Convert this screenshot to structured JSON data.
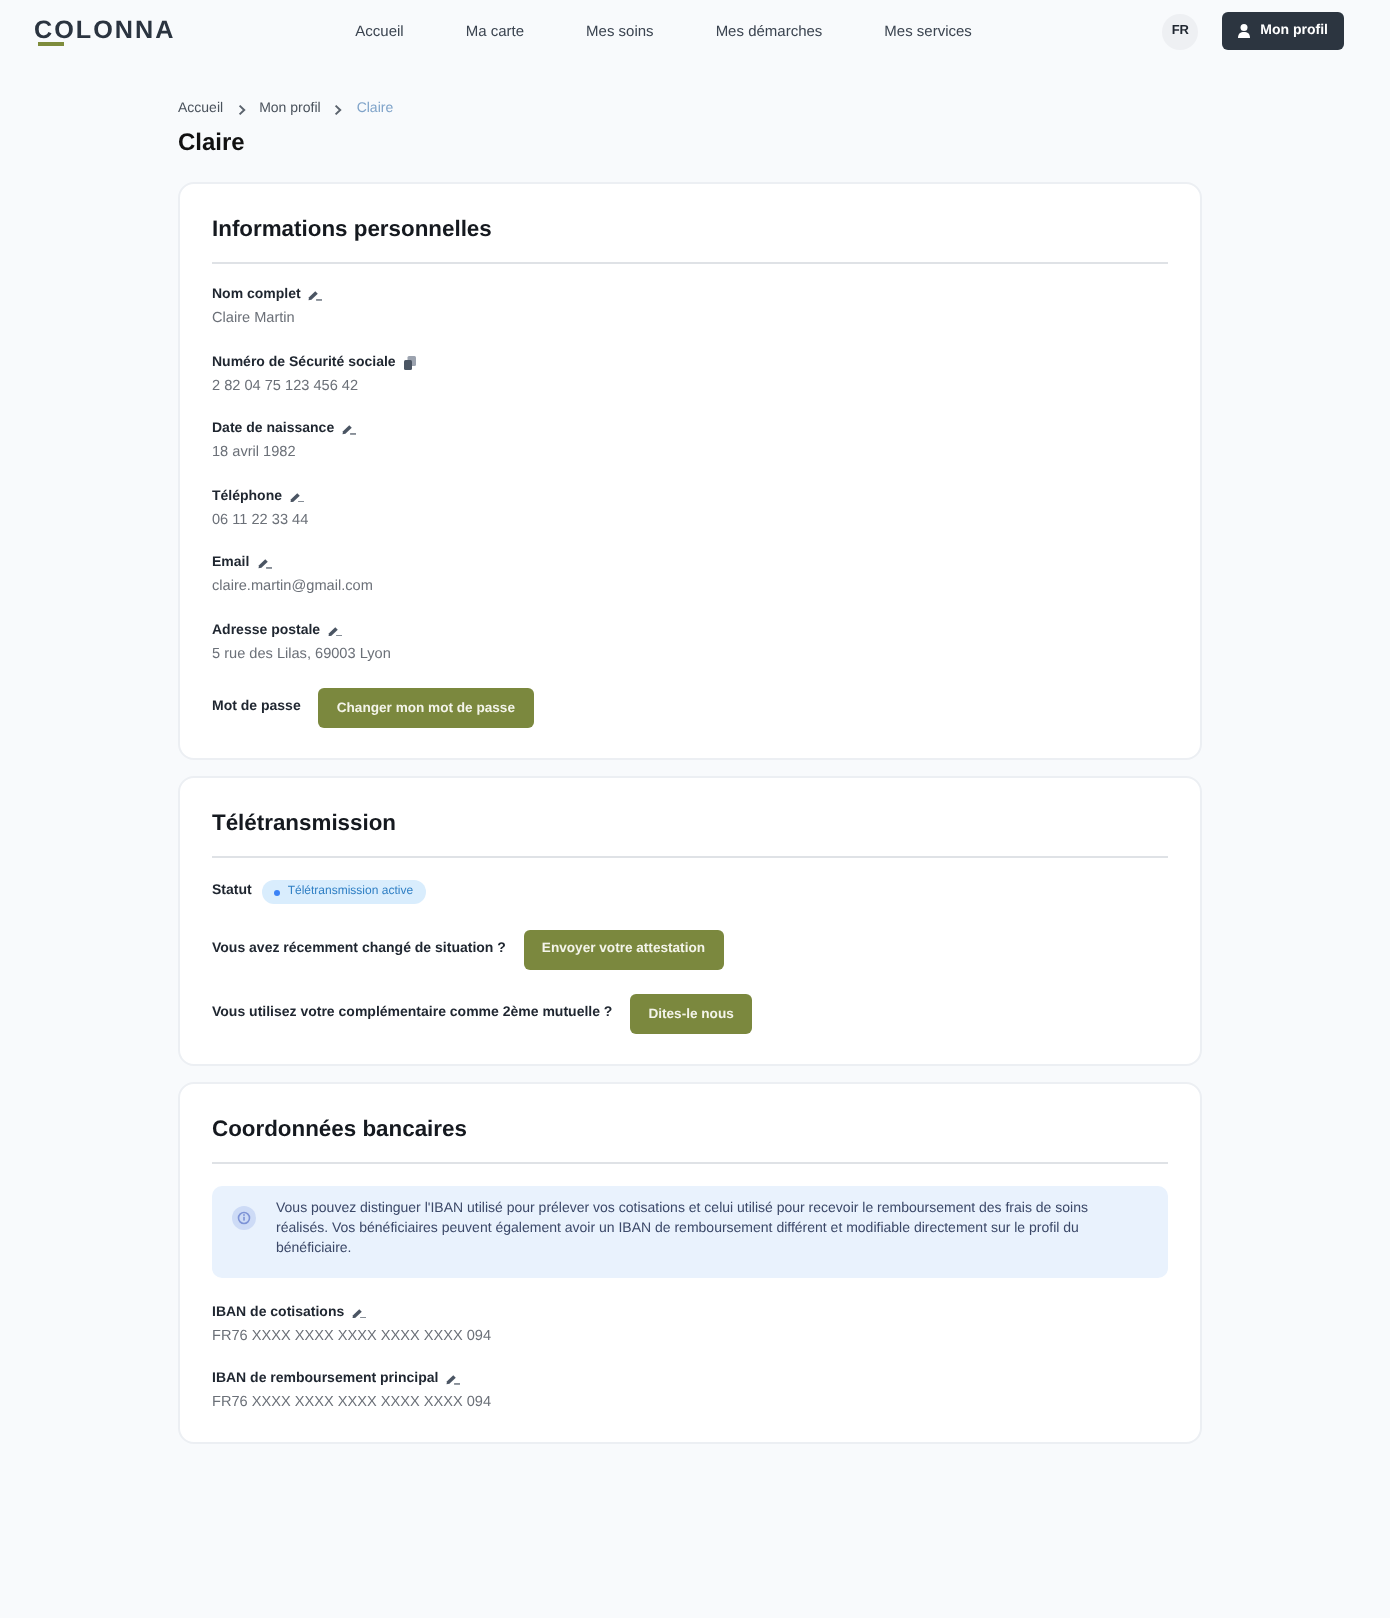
{
  "header": {
    "logo": "COLONNA",
    "nav": [
      "Accueil",
      "Ma carte",
      "Mes soins",
      "Mes démarches",
      "Mes services"
    ],
    "language": "FR",
    "profile_button": "Mon profil"
  },
  "breadcrumb": [
    {
      "label": "Accueil",
      "current": false
    },
    {
      "label": "Mon profil",
      "current": false
    },
    {
      "label": "Claire",
      "current": true
    }
  ],
  "page_title": "Claire",
  "sections": [
    {
      "title": "Informations personnelles",
      "rows": [
        {
          "kind": "editable_field",
          "label": "Nom complet",
          "value": "Claire Martin"
        },
        {
          "kind": "copyable_field",
          "label": "Numéro de Sécurité sociale",
          "value": "2 82 04 75 123 456 42"
        },
        {
          "kind": "editable_field",
          "label": "Date de naissance",
          "value": "18 avril 1982"
        },
        {
          "kind": "editable_field",
          "label": "Téléphone",
          "value": "06 11 22 33 44"
        },
        {
          "kind": "editable_field",
          "label": "Email",
          "value": "claire.martin@gmail.com"
        },
        {
          "kind": "editable_field",
          "label": "Adresse postale",
          "value": "5 rue des Lilas, 69003 Lyon"
        },
        {
          "kind": "action",
          "label": "Mot de passe",
          "button": "Changer mon mot de passe"
        }
      ]
    },
    {
      "title": "Télétransmission",
      "rows": [
        {
          "kind": "status",
          "label": "Statut",
          "badge": "Télétransmission active"
        },
        {
          "kind": "action",
          "label": "Vous avez récemment changé de situation ?",
          "button": "Envoyer votre attestation"
        },
        {
          "kind": "action",
          "label": "Vous utilisez votre complémentaire comme 2ème mutuelle ?",
          "button": "Dites-le nous"
        }
      ]
    },
    {
      "title": "Coordonnées bancaires",
      "rows": [
        {
          "kind": "notice",
          "text": "Vous pouvez distinguer l'IBAN utilisé pour prélever vos cotisations et celui utilisé pour recevoir le remboursement des frais de soins réalisés. Vos bénéficiaires peuvent également avoir un IBAN de remboursement différent et modifiable directement sur le profil du bénéficiaire."
        },
        {
          "kind": "editable_field",
          "label": "IBAN de cotisations",
          "value": "FR76 XXXX XXXX XXXX XXXX XXXX 094"
        },
        {
          "kind": "editable_field",
          "label": "IBAN de remboursement principal",
          "value": "FR76 XXXX XXXX XXXX XXXX XXXX 094"
        }
      ]
    }
  ]
}
